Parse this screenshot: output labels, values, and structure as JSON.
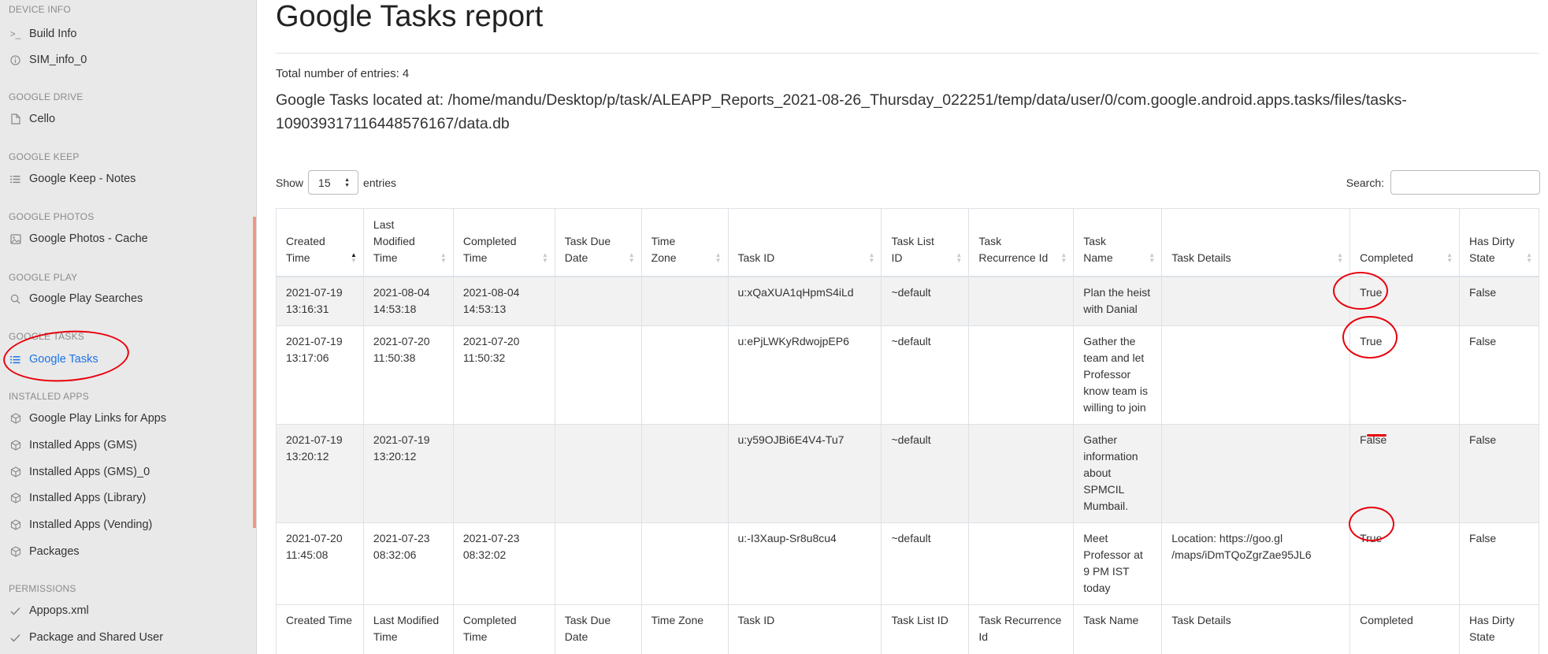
{
  "sidebar": {
    "sections": [
      {
        "title": "DEVICE INFO",
        "items": [
          {
            "label": "Build Info",
            "icon": "terminal-icon"
          },
          {
            "label": "SIM_info_0",
            "icon": "info-icon"
          }
        ]
      },
      {
        "title": "GOOGLE DRIVE",
        "items": [
          {
            "label": "Cello",
            "icon": "file-icon"
          }
        ]
      },
      {
        "title": "GOOGLE KEEP",
        "items": [
          {
            "label": "Google Keep - Notes",
            "icon": "list-icon"
          }
        ]
      },
      {
        "title": "GOOGLE PHOTOS",
        "items": [
          {
            "label": "Google Photos - Cache",
            "icon": "image-icon"
          }
        ]
      },
      {
        "title": "GOOGLE PLAY",
        "items": [
          {
            "label": "Google Play Searches",
            "icon": "search-icon"
          }
        ]
      },
      {
        "title": "GOOGLE TASKS",
        "items": [
          {
            "label": "Google Tasks",
            "icon": "list-icon",
            "active": true
          }
        ]
      },
      {
        "title": "INSTALLED APPS",
        "items": [
          {
            "label": "Google Play Links for Apps",
            "icon": "package-icon"
          },
          {
            "label": "Installed Apps (GMS)",
            "icon": "package-icon"
          },
          {
            "label": "Installed Apps (GMS)_0",
            "icon": "package-icon"
          },
          {
            "label": "Installed Apps (Library)",
            "icon": "package-icon"
          },
          {
            "label": "Installed Apps (Vending)",
            "icon": "package-icon"
          },
          {
            "label": "Packages",
            "icon": "package-icon"
          }
        ]
      },
      {
        "title": "PERMISSIONS",
        "items": [
          {
            "label": "Appops.xml",
            "icon": "check-icon"
          },
          {
            "label": "Package and Shared User",
            "icon": "check-icon"
          }
        ]
      }
    ],
    "active_color": "#1a73e8"
  },
  "main": {
    "title": "Google Tasks report",
    "total_entries": "Total number of entries: 4",
    "located_at": "Google Tasks located at: /home/mandu/Desktop/p/task/ALEAPP_Reports_2021-08-26_Thursday_022251/temp/data/user/0/com.google.android.apps.tasks/files/tasks-109039317116448576167/data.db",
    "show_label": "Show",
    "show_value": "15",
    "entries_label": "entries",
    "search_label": "Search:",
    "search_value": ""
  },
  "table": {
    "headers": [
      [
        "Created",
        "Time"
      ],
      [
        "Last",
        "Modified",
        "Time"
      ],
      [
        "Completed",
        "Time"
      ],
      [
        "Task Due",
        "Date"
      ],
      [
        "Time",
        "Zone"
      ],
      [
        "Task ID"
      ],
      [
        "Task List",
        "ID"
      ],
      [
        "Task",
        "Recurrence Id"
      ],
      [
        "Task",
        "Name"
      ],
      [
        "Task Details"
      ],
      [
        "Completed"
      ],
      [
        "Has Dirty",
        "State"
      ]
    ],
    "footer": [
      [
        "Created Time"
      ],
      [
        "Last Modified",
        "Time"
      ],
      [
        "Completed",
        "Time"
      ],
      [
        "Task Due",
        "Date"
      ],
      [
        "Time Zone"
      ],
      [
        "Task ID"
      ],
      [
        "Task List ID"
      ],
      [
        "Task Recurrence",
        "Id"
      ],
      [
        "Task Name"
      ],
      [
        "Task Details"
      ],
      [
        "Completed"
      ],
      [
        "Has Dirty",
        "State"
      ]
    ],
    "rows": [
      [
        [
          "2021-07-19",
          "13:16:31"
        ],
        [
          "2021-08-04",
          "14:53:18"
        ],
        [
          "2021-08-04",
          "14:53:13"
        ],
        [
          ""
        ],
        [
          ""
        ],
        [
          "u:xQaXUA1qHpmS4iLd"
        ],
        [
          "~default"
        ],
        [
          ""
        ],
        [
          "Plan the heist",
          "with Danial"
        ],
        [
          ""
        ],
        [
          "True"
        ],
        [
          "False"
        ]
      ],
      [
        [
          "2021-07-19",
          "13:17:06"
        ],
        [
          "2021-07-20",
          "11:50:38"
        ],
        [
          "2021-07-20",
          "11:50:32"
        ],
        [
          ""
        ],
        [
          ""
        ],
        [
          "u:ePjLWKyRdwojpEP6"
        ],
        [
          "~default"
        ],
        [
          ""
        ],
        [
          "Gather the",
          "team and let",
          "Professor",
          "know team is",
          "willing to join"
        ],
        [
          ""
        ],
        [
          "True"
        ],
        [
          "False"
        ]
      ],
      [
        [
          "2021-07-19",
          "13:20:12"
        ],
        [
          "2021-07-19",
          "13:20:12"
        ],
        [
          ""
        ],
        [
          ""
        ],
        [
          ""
        ],
        [
          "u:y59OJBi6E4V4-Tu7"
        ],
        [
          "~default"
        ],
        [
          ""
        ],
        [
          "Gather",
          "information",
          "about",
          "SPMCIL",
          "Mumbail."
        ],
        [
          ""
        ],
        [
          "False"
        ],
        [
          "False"
        ]
      ],
      [
        [
          "2021-07-20",
          "11:45:08"
        ],
        [
          "2021-07-23",
          "08:32:06"
        ],
        [
          "2021-07-23",
          "08:32:02"
        ],
        [
          ""
        ],
        [
          ""
        ],
        [
          "u:-I3Xaup-Sr8u8cu4"
        ],
        [
          "~default"
        ],
        [
          ""
        ],
        [
          "Meet",
          "Professor at",
          "9 PM IST",
          "today"
        ],
        [
          "Location: https://goo.gl",
          "/maps/iDmTQoZgrZae95JL6"
        ],
        [
          "True"
        ],
        [
          "False"
        ]
      ]
    ]
  },
  "annotation_color": "#e8000b"
}
